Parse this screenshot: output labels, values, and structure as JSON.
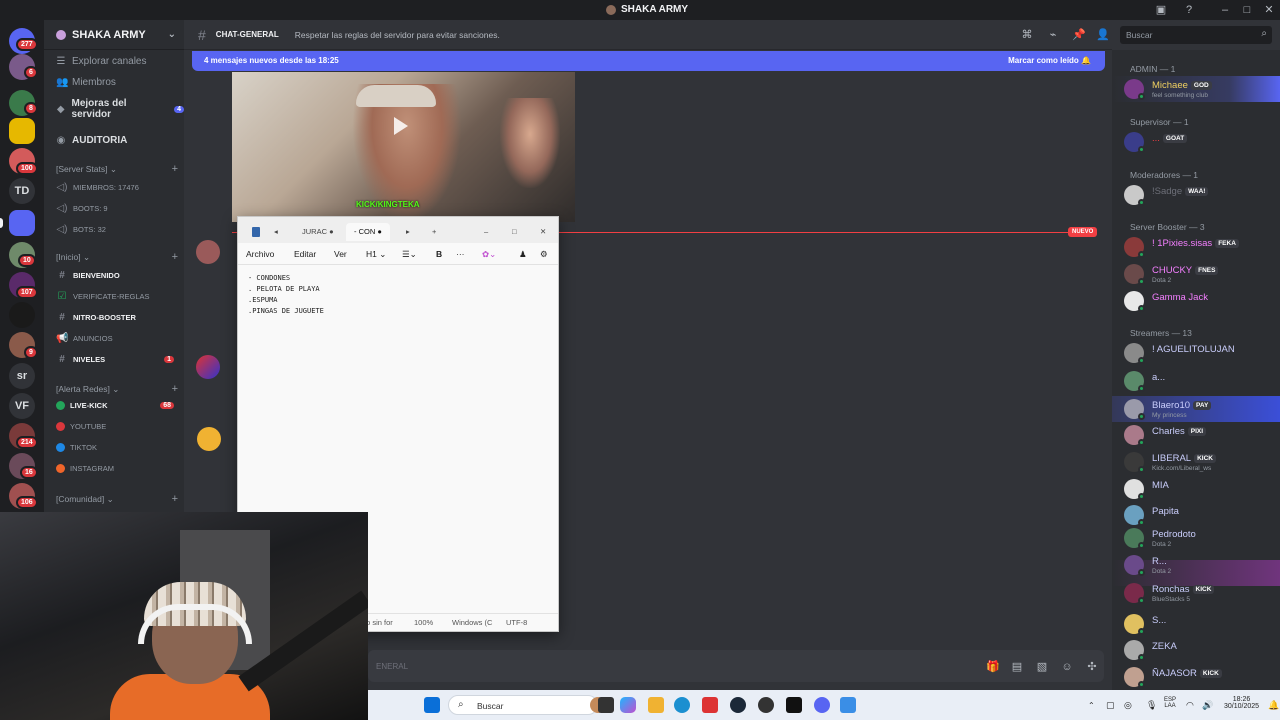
{
  "window": {
    "title": "SHAKA ARMY"
  },
  "rail": {
    "badges": [
      "277",
      "6",
      "8",
      "100",
      "10",
      "107",
      "9",
      "214",
      "16",
      "106"
    ],
    "text_servers": [
      "TD",
      "sr",
      "VF"
    ]
  },
  "server": {
    "name": "SHAKA ARMY"
  },
  "nav": {
    "explore": "Explorar canales",
    "members": "Miembros",
    "boosts": "Mejoras del servidor",
    "boosts_count": "4",
    "auditoria": "AUDITORIA"
  },
  "categories": {
    "server_stats": "[Server Stats]",
    "inicio": "[Inicio]",
    "alerta": "[Alerta Redes]",
    "comunidad": "[Comunidad]"
  },
  "stats": {
    "miembros": "MIEMBROS: 17476",
    "boots": "BOOTS: 9",
    "bots": "BOTS: 32"
  },
  "inicio_channels": [
    {
      "name": "BIENVENIDO",
      "count": ""
    },
    {
      "name": "VERIFICATE-REGLAS",
      "count": ""
    },
    {
      "name": "NITRO-BOOSTER",
      "count": ""
    },
    {
      "name": "ANUNCIOS",
      "count": ""
    },
    {
      "name": "NIVELES",
      "count": "1"
    }
  ],
  "alerta_channels": [
    {
      "name": "LIVE-KICK",
      "count": "68"
    },
    {
      "name": "YOUTUBE",
      "count": ""
    },
    {
      "name": "TIKTOK",
      "count": ""
    },
    {
      "name": "INSTAGRAM",
      "count": ""
    }
  ],
  "header": {
    "channel": "CHAT-GENERAL",
    "topic": "Respetar las reglas del servidor para evitar sanciones.",
    "search_placeholder": "Buscar"
  },
  "new_messages": {
    "text": "4 mensajes nuevos desde las 18:25",
    "mark_read": "Marcar como leído"
  },
  "video": {
    "caption": "KICK/KINGTEKA"
  },
  "divider": {
    "label": "NUEVO"
  },
  "notepad": {
    "tabs": [
      "JURAC",
      "- CON"
    ],
    "menu": [
      "Archivo",
      "Editar",
      "Ver"
    ],
    "heading_select": "H1",
    "lines": [
      "- CONDONES",
      ". PELOTA DE PLAYA",
      ".ESPUMA",
      ".PINGAS DE JUGUETE"
    ],
    "status": {
      "partial": "to sin for",
      "zoom": "100%",
      "eol": "Windows (C",
      "encoding": "UTF-8"
    }
  },
  "message_input": {
    "placeholder_partial": "ENERAL"
  },
  "taskbar": {
    "search": "Buscar",
    "lang": "ESP",
    "lang2": "LAA",
    "time": "18:26",
    "date": "30/10/2025"
  },
  "members": {
    "groups": [
      {
        "label": "ADMIN — 1"
      },
      {
        "label": "Supervisor — 1"
      },
      {
        "label": "Moderadores — 1"
      },
      {
        "label": "Server Booster — 3"
      },
      {
        "label": "Streamers — 13"
      }
    ],
    "list": [
      {
        "name": "Michaee",
        "tag": "GOD",
        "sub": "feel something club",
        "color": "#f0d060"
      },
      {
        "name": "...",
        "tag": "GOAT",
        "sub": "",
        "color": "#f23f43"
      },
      {
        "name": "!Sadge",
        "tag": "WAA!",
        "sub": "",
        "color": "#6d6f78"
      },
      {
        "name": "! 1Pixies.sisas",
        "tag": "FEKA",
        "sub": "",
        "color": "#f47fff"
      },
      {
        "name": "CHUCKY",
        "tag": "FNES",
        "sub": "Dota 2",
        "color": "#f47fff"
      },
      {
        "name": "Gamma Jack",
        "tag": "",
        "sub": "",
        "color": "#f47fff"
      },
      {
        "name": "! AGUELITOLUJAN",
        "tag": "",
        "sub": "",
        "color": "#c9cdfb"
      },
      {
        "name": "a...",
        "tag": "",
        "sub": "",
        "color": "#c9cdfb"
      },
      {
        "name": "Blaero10",
        "tag": "PAY",
        "sub": "My princess",
        "color": "#c9cdfb"
      },
      {
        "name": "Charles",
        "tag": "PIXI",
        "sub": "",
        "color": "#c9cdfb"
      },
      {
        "name": "LIBERAL",
        "tag": "KICK",
        "sub": "Kick.com/Liberal_ws",
        "color": "#c9cdfb"
      },
      {
        "name": "MIA",
        "tag": "",
        "sub": "",
        "color": "#c9cdfb"
      },
      {
        "name": "Papita",
        "tag": "",
        "sub": "",
        "color": "#c9cdfb"
      },
      {
        "name": "Pedrodoto",
        "tag": "",
        "sub": "Dota 2",
        "color": "#c9cdfb"
      },
      {
        "name": "R...",
        "tag": "",
        "sub": "Dota 2",
        "color": "#c9cdfb"
      },
      {
        "name": "Ronchas",
        "tag": "KICK",
        "sub": "BlueStacks 5",
        "color": "#c9cdfb"
      },
      {
        "name": "S...",
        "tag": "",
        "sub": "",
        "color": "#c9cdfb"
      },
      {
        "name": "ZEKA",
        "tag": "",
        "sub": "",
        "color": "#c9cdfb"
      },
      {
        "name": "ÑAJASOR",
        "tag": "KICK",
        "sub": "",
        "color": "#c9cdfb"
      }
    ]
  },
  "colors": {
    "accent": "#5865f2",
    "danger": "#f23f43",
    "online": "#23a55a",
    "kick": "#53fc18"
  }
}
